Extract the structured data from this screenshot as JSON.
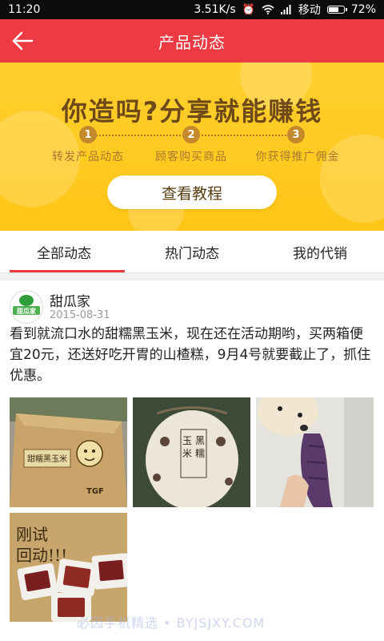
{
  "status_bar": {
    "time": "11:20",
    "speed": "3.51K/s",
    "carrier": "移动",
    "battery": "72%",
    "battery_level": 0.72
  },
  "header": {
    "title": "产品动态",
    "back_icon": "arrow-left-icon"
  },
  "banner": {
    "headline": "你造吗?分享就能赚钱",
    "steps": [
      {
        "number": "1",
        "label": "转发产品动态"
      },
      {
        "number": "2",
        "label": "顾客购买商品"
      },
      {
        "number": "3",
        "label": "你获得推广佣金"
      }
    ],
    "button_label": "查看教程",
    "colors": {
      "background": "#ffc617",
      "headline": "#6e4a1a",
      "step": "#c4892a"
    }
  },
  "tabs": [
    {
      "label": "全部动态",
      "active": true
    },
    {
      "label": "热门动态",
      "active": false
    },
    {
      "label": "我的代销",
      "active": false
    }
  ],
  "post": {
    "author": "甜瓜家",
    "avatar_text": "甜瓜家",
    "date": "2015-08-31",
    "text": "看到就流口水的甜糯黑玉米，现在还在活动期哟，买两箱便宜20元，还送好吃开胃的山楂糕，9月4号就要截止了，抓住优惠。",
    "photos": [
      {
        "subject": "cardboard box",
        "box_text": "甜糯黑玉米",
        "box_brand": "TGF"
      },
      {
        "subject": "corn sack",
        "bag_text": "黑糯玉米"
      },
      {
        "subject": "dog with purple corn"
      },
      {
        "subject": "hawthorn cake",
        "hand_text": "刚试 回动!!!"
      }
    ]
  },
  "watermark": "必因手机精选 • BYJSJXY.COM",
  "accent_color": "#ee3b43"
}
